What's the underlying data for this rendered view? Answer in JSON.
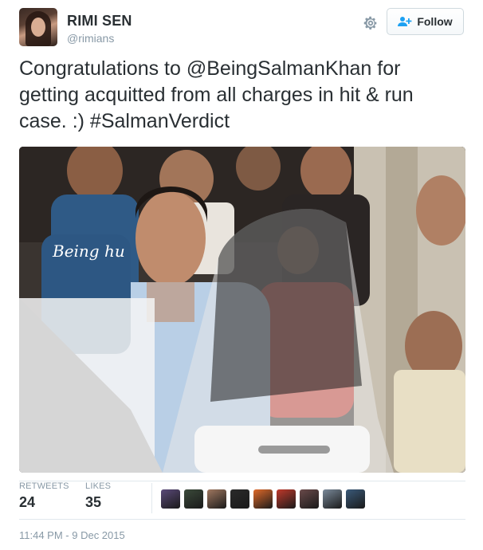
{
  "tweet": {
    "author": {
      "name": "RIMI SEN",
      "handle": "@rimians"
    },
    "follow_label": "Follow",
    "text_parts": [
      "Congratulations to ",
      "@BeingSalmanKhan",
      " for getting acquitted from all charges in hit & run case. :) ",
      "#SalmanVerdict"
    ],
    "photo_shirt_text": "Being hu",
    "stats": {
      "retweets_label": "RETWEETS",
      "retweets_count": "24",
      "likes_label": "LIKES",
      "likes_count": "35"
    },
    "likers_colors": [
      "#5b4a7a",
      "#3b4a3a",
      "#a07860",
      "#2a2a2a",
      "#e06a2a",
      "#c0392b",
      "#6a4a4a",
      "#7a8a9a",
      "#3a5a7a"
    ],
    "timestamp": "11:44 PM - 9 Dec 2015"
  },
  "icons": {
    "settings": "gear-icon",
    "follow": "add-user-icon"
  },
  "colors": {
    "text": "#292f33",
    "muted": "#8899a6",
    "border": "#e1e8ed"
  }
}
